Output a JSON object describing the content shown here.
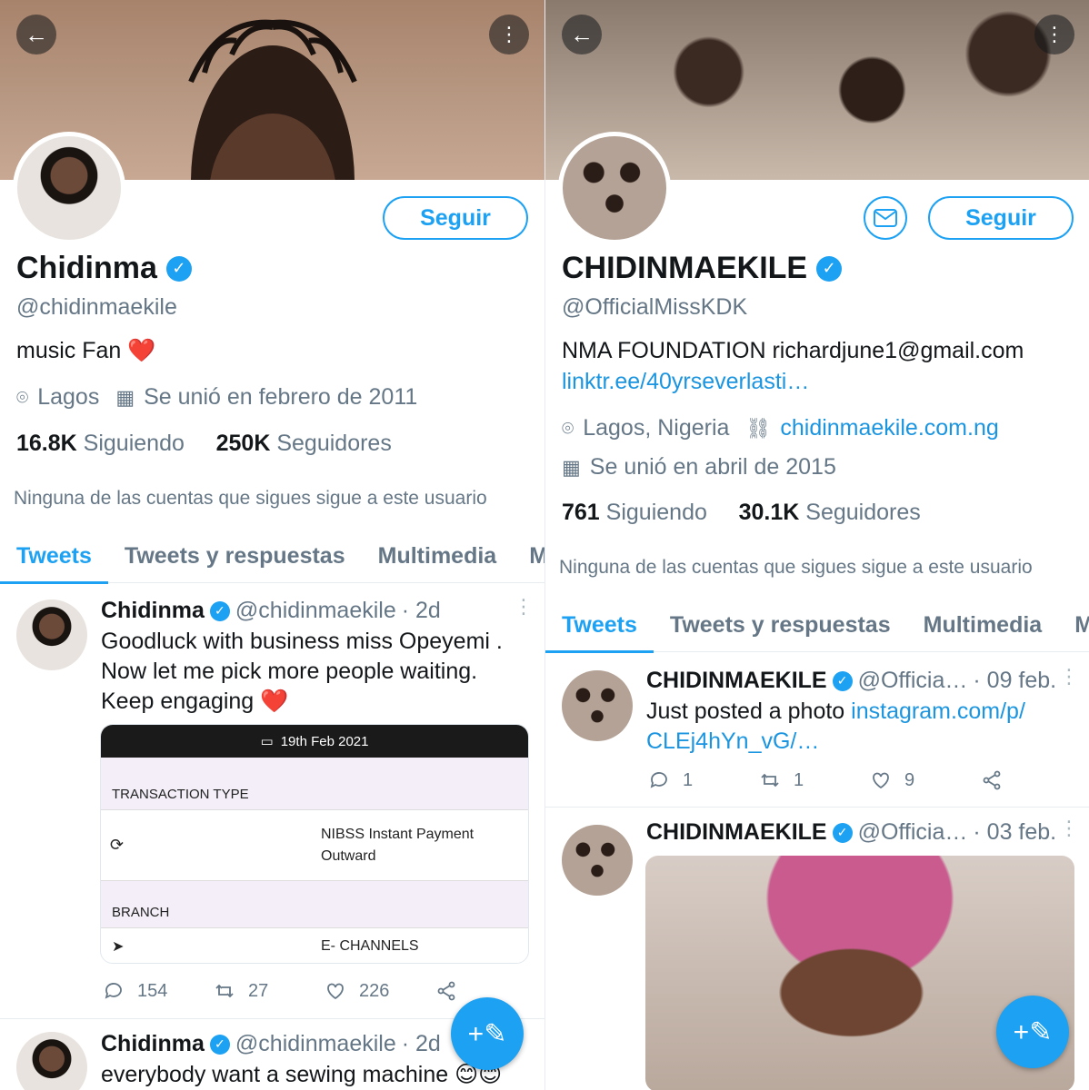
{
  "colors": {
    "accent": "#1da1f2",
    "muted": "#657786",
    "heart": "#e0245e"
  },
  "left": {
    "follow_label": "Seguir",
    "name": "Chidinma",
    "handle": "@chidinmaekile",
    "bio": "music Fan",
    "bio_emoji": "❤️",
    "location": "Lagos",
    "joined": "Se unió en febrero de 2011",
    "following_count": "16.8K",
    "following_label": "Siguiendo",
    "followers_count": "250K",
    "followers_label": "Seguidores",
    "note": "Ninguna de las cuentas que sigues sigue a este usuario",
    "tabs": [
      "Tweets",
      "Tweets y respuestas",
      "Multimedia",
      "Me"
    ],
    "tweets": [
      {
        "name": "Chidinma",
        "handle": "@chidinmaekile",
        "time": "· 2d",
        "lines": [
          "Goodluck with business miss Opeyemi .",
          "Now let me pick more people waiting.",
          "Keep engaging ❤️"
        ],
        "card": {
          "date": "19th Feb 2021",
          "transaction_type_label": "TRANSACTION TYPE",
          "transaction_type_value_1": "NIBSS Instant Payment",
          "transaction_type_value_2": "Outward",
          "branch_label": "BRANCH",
          "branch_value": "E- CHANNELS"
        },
        "replies": "154",
        "retweets": "27",
        "likes": "226"
      },
      {
        "name": "Chidinma",
        "handle": "@chidinmaekile",
        "time": "· 2d",
        "lines": [
          "everybody want a sewing machine 😊😊"
        ]
      }
    ]
  },
  "right": {
    "follow_label": "Seguir",
    "name": "CHIDINMAEKILE",
    "handle": "@OfficialMissKDK",
    "bio": "NMA FOUNDATION richardjune1@gmail.com",
    "bio_link": "linktr.ee/40yrseverlasti…",
    "location": "Lagos, Nigeria",
    "website": "chidinmaekile.com.ng",
    "joined": "Se unió en abril de 2015",
    "following_count": "761",
    "following_label": "Siguiendo",
    "followers_count": "30.1K",
    "followers_label": "Seguidores",
    "note": "Ninguna de las cuentas que sigues sigue a este usuario",
    "tabs": [
      "Tweets",
      "Tweets y respuestas",
      "Multimedia",
      "Me"
    ],
    "tweets": [
      {
        "name": "CHIDINMAEKILE",
        "handle": "@Officia…",
        "time": "· 09 feb.",
        "text": "Just posted a photo ",
        "link_1": "instagram.com/p/",
        "link_2": "CLEj4hYn_vG/…",
        "replies": "1",
        "retweets": "1",
        "likes": "9"
      },
      {
        "name": "CHIDINMAEKILE",
        "handle": "@Officia…",
        "time": "· 03 feb."
      }
    ]
  }
}
